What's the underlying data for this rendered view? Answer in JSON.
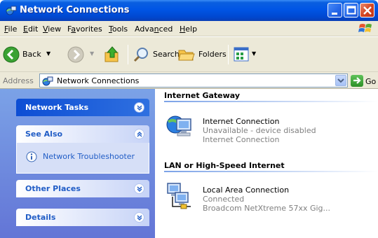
{
  "window": {
    "title": "Network Connections"
  },
  "menubar": {
    "items": [
      "File",
      "Edit",
      "View",
      "Favorites",
      "Tools",
      "Advanced",
      "Help"
    ],
    "underline": [
      "F",
      "E",
      "V",
      "a",
      "T",
      "n",
      "H"
    ]
  },
  "toolbar": {
    "back_label": "Back",
    "search_label": "Search",
    "folders_label": "Folders"
  },
  "addressbar": {
    "label": "Address",
    "value": "Network Connections",
    "go_label": "Go"
  },
  "leftpanel": {
    "network_tasks": "Network Tasks",
    "see_also": "See Also",
    "see_also_link": "Network Troubleshooter",
    "other_places": "Other Places",
    "details": "Details"
  },
  "content": {
    "groups": [
      {
        "header": "Internet Gateway",
        "items": [
          {
            "name": "Internet Connection",
            "status": "Unavailable - device disabled",
            "device": "Internet Connection"
          }
        ]
      },
      {
        "header": "LAN or High-Speed Internet",
        "items": [
          {
            "name": "Local Area Connection",
            "status": "Connected",
            "device": "Broadcom NetXtreme 57xx Gig..."
          }
        ]
      }
    ]
  },
  "colors": {
    "titlebar_blue": "#0055e5",
    "panel_blue": "#6375d6",
    "link_blue": "#215dc6"
  }
}
